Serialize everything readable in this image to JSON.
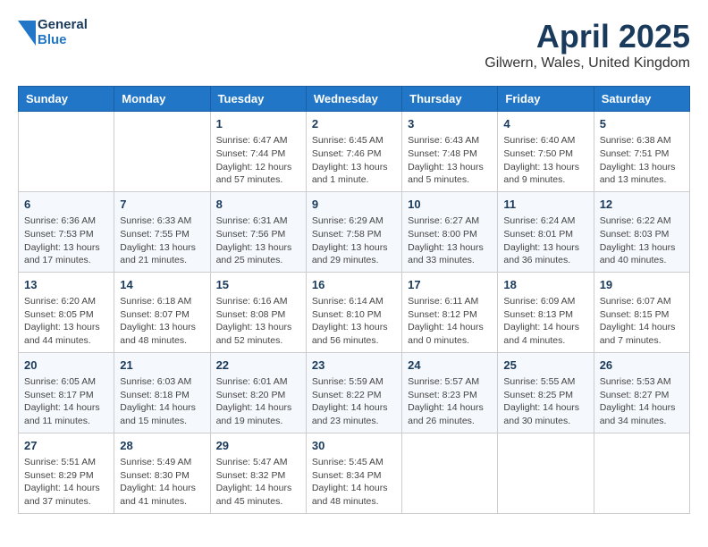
{
  "header": {
    "logo_line1": "General",
    "logo_line2": "Blue",
    "title": "April 2025",
    "subtitle": "Gilwern, Wales, United Kingdom"
  },
  "calendar": {
    "days_of_week": [
      "Sunday",
      "Monday",
      "Tuesday",
      "Wednesday",
      "Thursday",
      "Friday",
      "Saturday"
    ],
    "weeks": [
      [
        {
          "day": "",
          "info": ""
        },
        {
          "day": "",
          "info": ""
        },
        {
          "day": "1",
          "info": "Sunrise: 6:47 AM\nSunset: 7:44 PM\nDaylight: 12 hours and 57 minutes."
        },
        {
          "day": "2",
          "info": "Sunrise: 6:45 AM\nSunset: 7:46 PM\nDaylight: 13 hours and 1 minute."
        },
        {
          "day": "3",
          "info": "Sunrise: 6:43 AM\nSunset: 7:48 PM\nDaylight: 13 hours and 5 minutes."
        },
        {
          "day": "4",
          "info": "Sunrise: 6:40 AM\nSunset: 7:50 PM\nDaylight: 13 hours and 9 minutes."
        },
        {
          "day": "5",
          "info": "Sunrise: 6:38 AM\nSunset: 7:51 PM\nDaylight: 13 hours and 13 minutes."
        }
      ],
      [
        {
          "day": "6",
          "info": "Sunrise: 6:36 AM\nSunset: 7:53 PM\nDaylight: 13 hours and 17 minutes."
        },
        {
          "day": "7",
          "info": "Sunrise: 6:33 AM\nSunset: 7:55 PM\nDaylight: 13 hours and 21 minutes."
        },
        {
          "day": "8",
          "info": "Sunrise: 6:31 AM\nSunset: 7:56 PM\nDaylight: 13 hours and 25 minutes."
        },
        {
          "day": "9",
          "info": "Sunrise: 6:29 AM\nSunset: 7:58 PM\nDaylight: 13 hours and 29 minutes."
        },
        {
          "day": "10",
          "info": "Sunrise: 6:27 AM\nSunset: 8:00 PM\nDaylight: 13 hours and 33 minutes."
        },
        {
          "day": "11",
          "info": "Sunrise: 6:24 AM\nSunset: 8:01 PM\nDaylight: 13 hours and 36 minutes."
        },
        {
          "day": "12",
          "info": "Sunrise: 6:22 AM\nSunset: 8:03 PM\nDaylight: 13 hours and 40 minutes."
        }
      ],
      [
        {
          "day": "13",
          "info": "Sunrise: 6:20 AM\nSunset: 8:05 PM\nDaylight: 13 hours and 44 minutes."
        },
        {
          "day": "14",
          "info": "Sunrise: 6:18 AM\nSunset: 8:07 PM\nDaylight: 13 hours and 48 minutes."
        },
        {
          "day": "15",
          "info": "Sunrise: 6:16 AM\nSunset: 8:08 PM\nDaylight: 13 hours and 52 minutes."
        },
        {
          "day": "16",
          "info": "Sunrise: 6:14 AM\nSunset: 8:10 PM\nDaylight: 13 hours and 56 minutes."
        },
        {
          "day": "17",
          "info": "Sunrise: 6:11 AM\nSunset: 8:12 PM\nDaylight: 14 hours and 0 minutes."
        },
        {
          "day": "18",
          "info": "Sunrise: 6:09 AM\nSunset: 8:13 PM\nDaylight: 14 hours and 4 minutes."
        },
        {
          "day": "19",
          "info": "Sunrise: 6:07 AM\nSunset: 8:15 PM\nDaylight: 14 hours and 7 minutes."
        }
      ],
      [
        {
          "day": "20",
          "info": "Sunrise: 6:05 AM\nSunset: 8:17 PM\nDaylight: 14 hours and 11 minutes."
        },
        {
          "day": "21",
          "info": "Sunrise: 6:03 AM\nSunset: 8:18 PM\nDaylight: 14 hours and 15 minutes."
        },
        {
          "day": "22",
          "info": "Sunrise: 6:01 AM\nSunset: 8:20 PM\nDaylight: 14 hours and 19 minutes."
        },
        {
          "day": "23",
          "info": "Sunrise: 5:59 AM\nSunset: 8:22 PM\nDaylight: 14 hours and 23 minutes."
        },
        {
          "day": "24",
          "info": "Sunrise: 5:57 AM\nSunset: 8:23 PM\nDaylight: 14 hours and 26 minutes."
        },
        {
          "day": "25",
          "info": "Sunrise: 5:55 AM\nSunset: 8:25 PM\nDaylight: 14 hours and 30 minutes."
        },
        {
          "day": "26",
          "info": "Sunrise: 5:53 AM\nSunset: 8:27 PM\nDaylight: 14 hours and 34 minutes."
        }
      ],
      [
        {
          "day": "27",
          "info": "Sunrise: 5:51 AM\nSunset: 8:29 PM\nDaylight: 14 hours and 37 minutes."
        },
        {
          "day": "28",
          "info": "Sunrise: 5:49 AM\nSunset: 8:30 PM\nDaylight: 14 hours and 41 minutes."
        },
        {
          "day": "29",
          "info": "Sunrise: 5:47 AM\nSunset: 8:32 PM\nDaylight: 14 hours and 45 minutes."
        },
        {
          "day": "30",
          "info": "Sunrise: 5:45 AM\nSunset: 8:34 PM\nDaylight: 14 hours and 48 minutes."
        },
        {
          "day": "",
          "info": ""
        },
        {
          "day": "",
          "info": ""
        },
        {
          "day": "",
          "info": ""
        }
      ]
    ]
  }
}
